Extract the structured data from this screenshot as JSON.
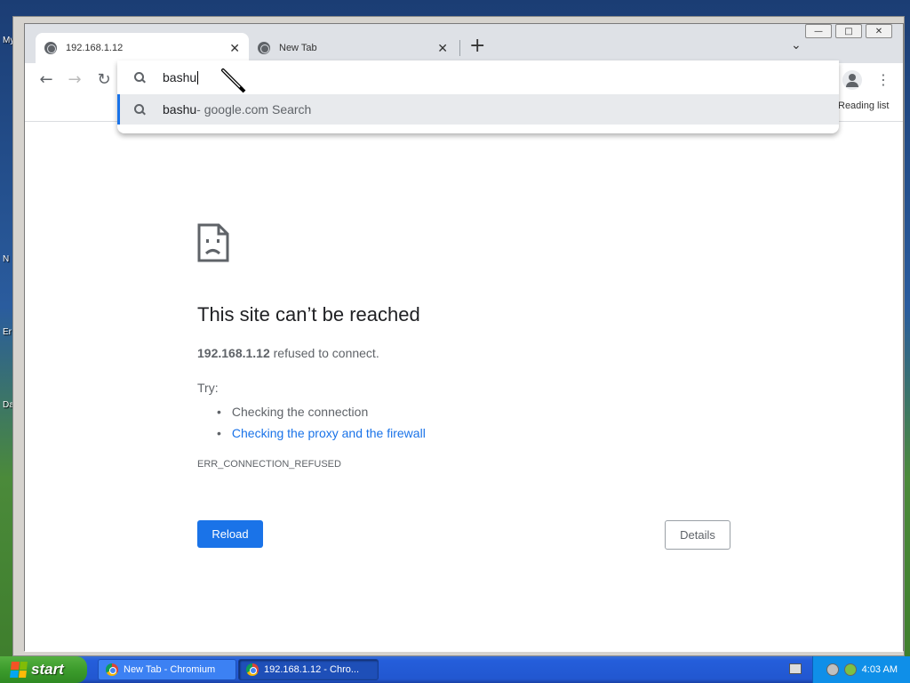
{
  "desktop": {
    "labels": [
      "My",
      "N",
      "Er",
      "Da"
    ]
  },
  "browser": {
    "tabs": [
      {
        "title": "192.168.1.12",
        "active": true
      },
      {
        "title": "New Tab",
        "active": false
      }
    ],
    "window_controls": {
      "minimize": "—",
      "maximize": "□",
      "close": "✕"
    },
    "omnibox": {
      "input_value": "bashu",
      "suggestion_query": "bashu",
      "suggestion_suffix": " - google.com Search"
    },
    "bookmarks": {
      "reading_list": "Reading list"
    }
  },
  "page": {
    "title": "This site can’t be reached",
    "host": "192.168.1.12",
    "message": " refused to connect.",
    "try_label": "Try:",
    "suggestions": [
      {
        "text": "Checking the connection",
        "link": false
      },
      {
        "text": "Checking the proxy and the firewall",
        "link": true
      }
    ],
    "error_code": "ERR_CONNECTION_REFUSED",
    "reload_label": "Reload",
    "details_label": "Details"
  },
  "taskbar": {
    "start_label": "start",
    "tasks": [
      {
        "label": "New Tab - Chromium",
        "active": false
      },
      {
        "label": "192.168.1.12 - Chro...",
        "active": true
      }
    ],
    "clock": "4:03 AM"
  },
  "colors": {
    "accent": "#1a73e8",
    "text": "#202124",
    "muted": "#5f6368"
  }
}
